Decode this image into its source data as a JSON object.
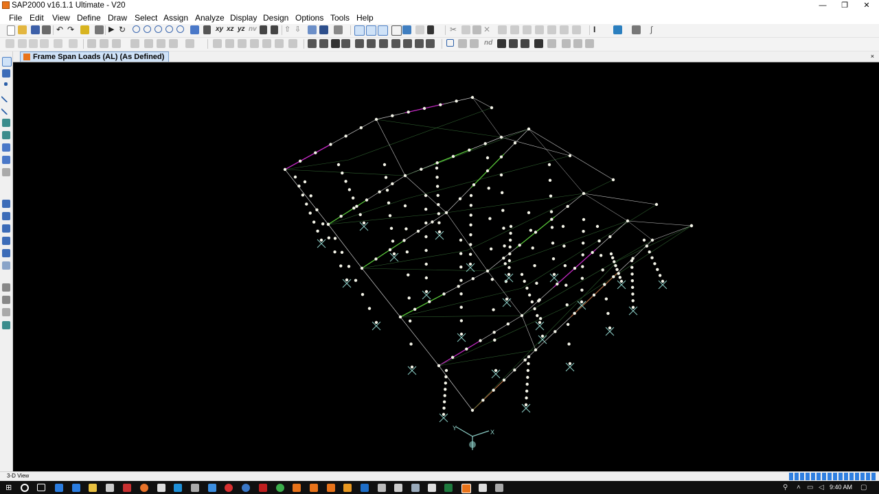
{
  "window": {
    "title": "SAP2000 v16.1.1 Ultimate  - V20",
    "minimize_glyph": "—",
    "restore_glyph": "❐",
    "close_glyph": "✕"
  },
  "menu": [
    "File",
    "Edit",
    "View",
    "Define",
    "Draw",
    "Select",
    "Assign",
    "Analyze",
    "Display",
    "Design",
    "Options",
    "Tools",
    "Help"
  ],
  "toolbar": {
    "view_xy": "xy",
    "view_xz": "xz",
    "view_yz": "yz",
    "view_nv": "nv",
    "label_nd": "nd"
  },
  "tab": {
    "label": "Frame Span Loads (AL) (As Defined)",
    "close_glyph": "×"
  },
  "viewport": {
    "background": "#000000",
    "axis_x_label": "X",
    "axis_y_label": "Y",
    "colors": {
      "frame": "#c9c9c9",
      "brace": "#2e5e2e",
      "load_magenta": "#c428c4",
      "load_green": "#58c838",
      "load_brown": "#a0603a",
      "joint": "#f4f4e8",
      "support": "#8ed0c8"
    }
  },
  "status": {
    "view_name": "3-D View",
    "progress_color": "#2f7fe0"
  },
  "taskbar": {
    "time": "9:40 AM",
    "start_icon": "windows-start-icon",
    "search_icon": "cortana-search-icon"
  }
}
